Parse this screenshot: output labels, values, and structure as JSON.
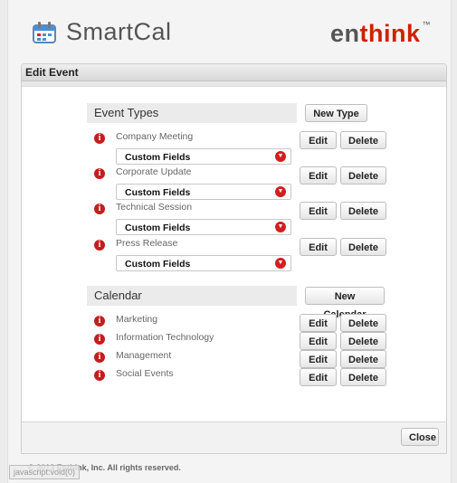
{
  "header": {
    "app_name": "SmartCal",
    "brand_prefix": "en",
    "brand_highlight": "think",
    "brand_tm": "™"
  },
  "panel": {
    "title": "Edit Event"
  },
  "event_types": {
    "heading": "Event Types",
    "new_button": "New Type",
    "items": [
      {
        "name": "Company Meeting",
        "field": "Custom Fields",
        "edit": "Edit",
        "delete": "Delete"
      },
      {
        "name": "Corporate Update",
        "field": "Custom Fields",
        "edit": "Edit",
        "delete": "Delete"
      },
      {
        "name": "Technical Session",
        "field": "Custom Fields",
        "edit": "Edit",
        "delete": "Delete"
      },
      {
        "name": "Press Release",
        "field": "Custom Fields",
        "edit": "Edit",
        "delete": "Delete"
      }
    ]
  },
  "calendar": {
    "heading": "Calendar",
    "new_button": "New Calendar",
    "items": [
      {
        "name": "Marketing",
        "edit": "Edit",
        "delete": "Delete"
      },
      {
        "name": "Information Technology",
        "edit": "Edit",
        "delete": "Delete"
      },
      {
        "name": "Management",
        "edit": "Edit",
        "delete": "Delete"
      },
      {
        "name": "Social Events",
        "edit": "Edit",
        "delete": "Delete"
      }
    ]
  },
  "footer": {
    "close_label": "Close"
  },
  "copyright": "© 2013 Enthink, Inc. All rights reserved.",
  "status_tip": "javascript:void(0)",
  "colors": {
    "accent": "#cc2200",
    "info_icon": "#c41d1d"
  }
}
